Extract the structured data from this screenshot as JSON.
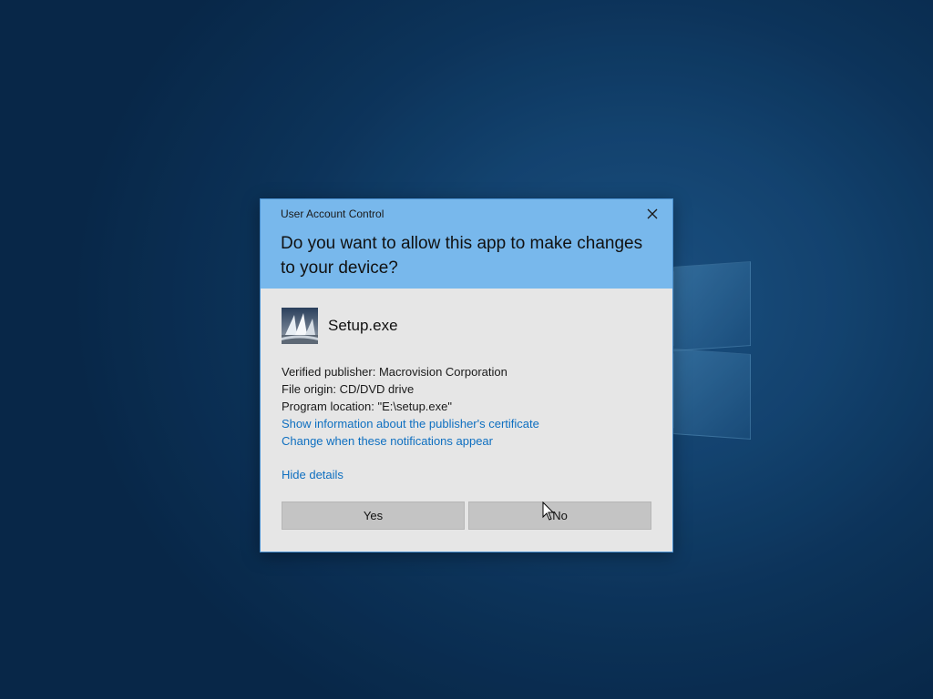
{
  "dialog": {
    "window_title": "User Account Control",
    "question": "Do you want to allow this app to make changes to your device?",
    "app_name": "Setup.exe",
    "details": {
      "publisher": "Verified publisher: Macrovision Corporation",
      "origin": "File origin: CD/DVD drive",
      "location": "Program location: \"E:\\setup.exe\""
    },
    "links": {
      "certificate": "Show information about the publisher's certificate",
      "notifications": "Change when these notifications appear",
      "hide_details": "Hide details"
    },
    "buttons": {
      "yes": "Yes",
      "no": "No"
    }
  },
  "icons": {
    "close": "close-icon",
    "app": "setup-app-icon",
    "cursor": "mouse-cursor-icon"
  },
  "colors": {
    "header": "#78b8ec",
    "body": "#e6e6e6",
    "link": "#0e6fc0",
    "button": "#c4c4c4"
  }
}
